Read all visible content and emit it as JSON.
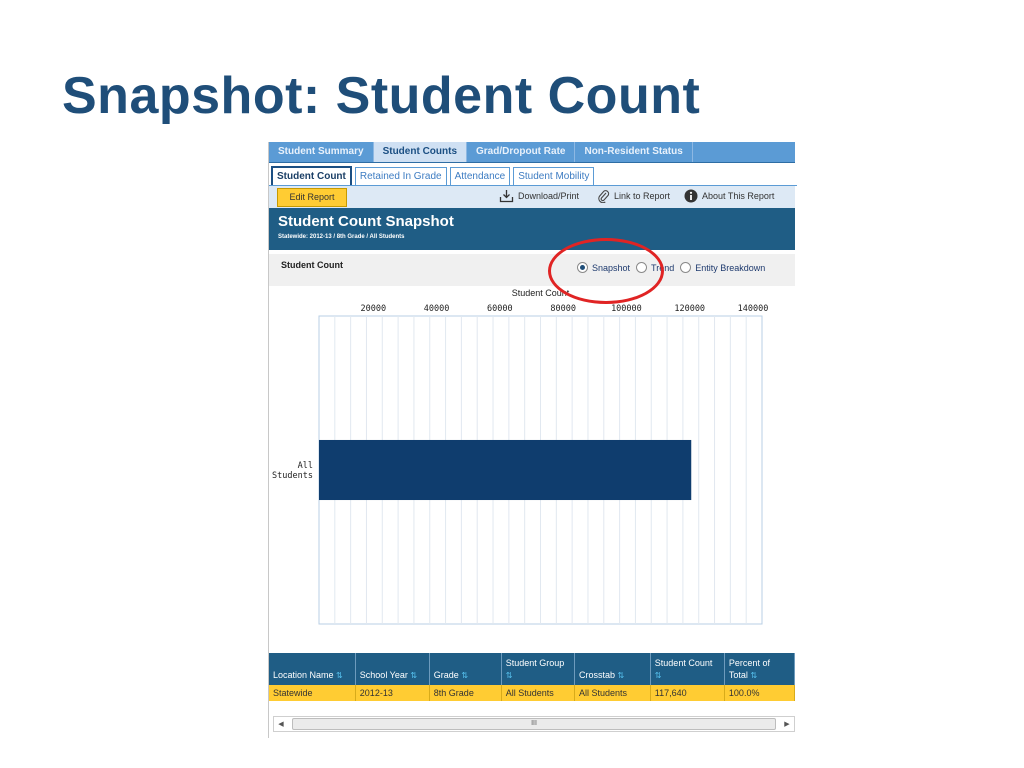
{
  "slide": {
    "title": "Snapshot: Student Count"
  },
  "tabs_main": [
    {
      "label": "Student Summary",
      "active": false
    },
    {
      "label": "Student Counts",
      "active": true
    },
    {
      "label": "Grad/Dropout Rate",
      "active": false
    },
    {
      "label": "Non-Resident Status",
      "active": false
    }
  ],
  "tabs_sub": [
    {
      "label": "Student Count",
      "active": true
    },
    {
      "label": "Retained In Grade",
      "active": false
    },
    {
      "label": "Attendance",
      "active": false
    },
    {
      "label": "Student Mobility",
      "active": false
    }
  ],
  "toolbar": {
    "edit_label": "Edit Report",
    "download_label": "Download/Print",
    "link_label": "Link to Report",
    "about_label": "About This Report"
  },
  "report": {
    "title": "Student Count Snapshot",
    "subtitle": "Statewide: 2012-13 / 8th Grade / All Students"
  },
  "control": {
    "label": "Student Count",
    "options": [
      {
        "label": "Snapshot",
        "checked": true
      },
      {
        "label": "Trend",
        "checked": false
      },
      {
        "label": "Entity Breakdown",
        "checked": false
      }
    ]
  },
  "colors": {
    "bar": "#0f3d6e",
    "header": "#1f5d85",
    "row_highlight": "#ffcc33",
    "annotation_ring": "#e02424"
  },
  "chart_data": {
    "type": "bar",
    "orientation": "horizontal",
    "title": "Student Count",
    "categories": [
      "All Students"
    ],
    "values": [
      117640
    ],
    "xlim": [
      0,
      140000
    ],
    "xticks": [
      20000,
      40000,
      60000,
      80000,
      100000,
      120000,
      140000
    ],
    "xtick_labels": [
      "20000",
      "40000",
      "60000",
      "80000",
      "100000",
      "120000",
      "140000"
    ],
    "axis_position": "top",
    "grid": true
  },
  "table": {
    "columns": [
      {
        "label": "Location Name",
        "sortable": true
      },
      {
        "label": "School Year",
        "sortable": true
      },
      {
        "label": "Grade",
        "sortable": true
      },
      {
        "label": "Student Group",
        "sortable": true
      },
      {
        "label": "Crosstab",
        "sortable": true
      },
      {
        "label": "Student Count",
        "sortable": true
      },
      {
        "label": "Percent of Total",
        "sortable": true
      }
    ],
    "rows": [
      [
        "Statewide",
        "2012-13",
        "8th Grade",
        "All Students",
        "All Students",
        "117,640",
        "100.0%"
      ]
    ]
  },
  "scrollbar": {
    "thumb_label": "III"
  }
}
